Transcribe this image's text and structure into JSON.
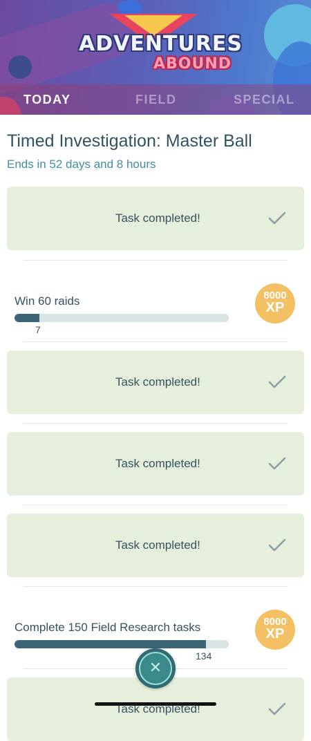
{
  "header": {
    "logo_line1": "ADVENTURES",
    "logo_line2": "ABOUND",
    "tabs": [
      {
        "label": "TODAY",
        "active": true
      },
      {
        "label": "FIELD",
        "active": false
      },
      {
        "label": "SPECIAL",
        "active": false
      }
    ]
  },
  "research": {
    "title": "Timed Investigation: Master Ball",
    "subtitle": "Ends in 52 days and 8 hours"
  },
  "tasks": [
    {
      "type": "completed",
      "text": "Task completed!"
    },
    {
      "type": "progress",
      "label": "Win 60 raids",
      "current": "7",
      "target": 60,
      "progress": 0.117,
      "reward_value": "8000",
      "reward_unit": "XP"
    },
    {
      "type": "completed",
      "text": "Task completed!"
    },
    {
      "type": "completed",
      "text": "Task completed!"
    },
    {
      "type": "completed",
      "text": "Task completed!"
    },
    {
      "type": "progress",
      "label": "Complete 150 Field Research tasks",
      "current": "134",
      "target": 150,
      "progress": 0.893,
      "reward_value": "8000",
      "reward_unit": "XP"
    },
    {
      "type": "completed",
      "text": "Task completed!"
    }
  ],
  "icons": {
    "check": "check-icon",
    "close": "close-icon"
  },
  "colors": {
    "card_bg": "#e6efdc",
    "bar_fill": "#3c6575",
    "bar_track": "#d8e4e3",
    "xp_badge": "#f3c063",
    "subtitle": "#3f8ea0",
    "close_button": "#2f6b73"
  }
}
